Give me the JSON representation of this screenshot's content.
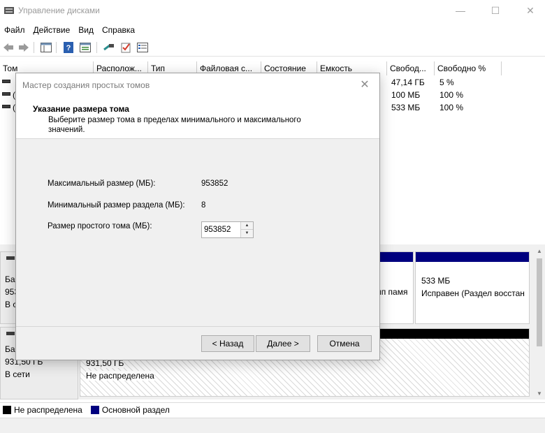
{
  "window": {
    "title": "Управление дисками",
    "minimize_glyph": "—",
    "maximize_glyph": "☐",
    "close_glyph": "✕"
  },
  "menu": [
    "Файл",
    "Действие",
    "Вид",
    "Справка"
  ],
  "toolbar": {
    "icons": [
      "back-icon",
      "forward-icon",
      "console-tree-icon",
      "help-icon",
      "properties-icon",
      "connect-icon",
      "checklist-icon",
      "list-view-icon"
    ]
  },
  "volume_list": {
    "columns": [
      "Том",
      "Располож...",
      "Тип",
      "Файловая с...",
      "Состояние",
      "Емкость",
      "Свобод...",
      "Свободно %"
    ],
    "rows": [
      {
        "name": "",
        "free": "47,14 ГБ",
        "free_pct": "5 %"
      },
      {
        "name": "(",
        "free": "100 МБ",
        "free_pct": "100 %"
      },
      {
        "name": "(",
        "free": "533 МБ",
        "free_pct": "100 %"
      }
    ]
  },
  "disks": [
    {
      "label_lines": [
        "Ба",
        "953",
        "В с"
      ],
      "partitions": [
        {
          "lines": [
            "",
            "ип памя"
          ],
          "color": "#00007f"
        },
        {
          "lines": [
            "533 МБ",
            "Исправен (Раздел восстан"
          ],
          "color": "#00007f"
        }
      ]
    },
    {
      "label_lines": [
        "Ба",
        "931,50 ГБ",
        "В сети"
      ],
      "partitions": [
        {
          "lines": [
            "931,50 ГБ",
            "Не распределена"
          ],
          "color": "#000000"
        }
      ]
    }
  ],
  "legend": [
    {
      "label": "Не распределена",
      "color": "#000000"
    },
    {
      "label": "Основной раздел",
      "color": "#00007f"
    }
  ],
  "dialog": {
    "title": "Мастер создания простых томов",
    "heading": "Указание размера тома",
    "description": "Выберите размер тома в пределах минимального и максимального значений.",
    "fields": {
      "max_label": "Максимальный размер (МБ):",
      "max_value": "953852",
      "min_label": "Минимальный размер раздела (МБ):",
      "min_value": "8",
      "size_label": "Размер простого тома (МБ):",
      "size_value": "953852"
    },
    "buttons": {
      "back": "< Назад",
      "next": "Далее >",
      "cancel": "Отмена"
    }
  }
}
